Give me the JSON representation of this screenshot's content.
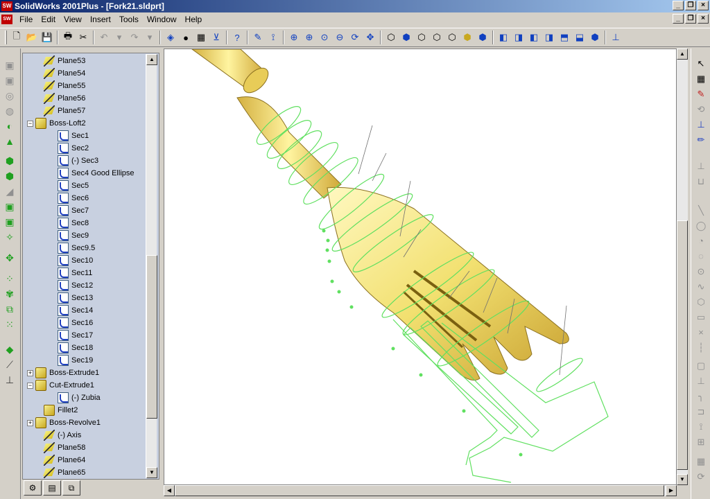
{
  "window": {
    "title": "SolidWorks 2001Plus - [Fork21.sldprt]",
    "app_icon": "solidworks-logo-icon"
  },
  "menu": {
    "items": [
      "File",
      "Edit",
      "View",
      "Insert",
      "Tools",
      "Window",
      "Help"
    ]
  },
  "feature_tree": {
    "items": [
      {
        "label": "Plane53",
        "icon": "plane-icon",
        "indent": 1
      },
      {
        "label": "Plane54",
        "icon": "plane-icon",
        "indent": 1
      },
      {
        "label": "Plane55",
        "icon": "plane-icon",
        "indent": 1
      },
      {
        "label": "Plane56",
        "icon": "plane-icon",
        "indent": 1
      },
      {
        "label": "Plane57",
        "icon": "plane-icon",
        "indent": 1
      },
      {
        "label": "Boss-Loft2",
        "icon": "loft-icon",
        "indent": 0,
        "expander": "−"
      },
      {
        "label": "Sec1",
        "icon": "sketch-icon",
        "indent": 2
      },
      {
        "label": "Sec2",
        "icon": "sketch-icon",
        "indent": 2
      },
      {
        "label": "(-) Sec3",
        "icon": "sketch-icon",
        "indent": 2
      },
      {
        "label": "Sec4 Good Ellipse",
        "icon": "sketch-icon",
        "indent": 2
      },
      {
        "label": "Sec5",
        "icon": "sketch-icon",
        "indent": 2
      },
      {
        "label": "Sec6",
        "icon": "sketch-icon",
        "indent": 2
      },
      {
        "label": "Sec7",
        "icon": "sketch-icon",
        "indent": 2
      },
      {
        "label": "Sec8",
        "icon": "sketch-icon",
        "indent": 2
      },
      {
        "label": "Sec9",
        "icon": "sketch-icon",
        "indent": 2
      },
      {
        "label": "Sec9.5",
        "icon": "sketch-icon",
        "indent": 2
      },
      {
        "label": "Sec10",
        "icon": "sketch-icon",
        "indent": 2
      },
      {
        "label": "Sec11",
        "icon": "sketch-icon",
        "indent": 2
      },
      {
        "label": "Sec12",
        "icon": "sketch-icon",
        "indent": 2
      },
      {
        "label": "Sec13",
        "icon": "sketch-icon",
        "indent": 2
      },
      {
        "label": "Sec14",
        "icon": "sketch-icon",
        "indent": 2
      },
      {
        "label": "Sec16",
        "icon": "sketch-icon",
        "indent": 2
      },
      {
        "label": "Sec17",
        "icon": "sketch-icon",
        "indent": 2
      },
      {
        "label": "Sec18",
        "icon": "sketch-icon",
        "indent": 2
      },
      {
        "label": "Sec19",
        "icon": "sketch-icon",
        "indent": 2
      },
      {
        "label": "Boss-Extrude1",
        "icon": "extrude-icon",
        "indent": 0,
        "expander": "+"
      },
      {
        "label": "Cut-Extrude1",
        "icon": "cut-extrude-icon",
        "indent": 0,
        "expander": "−"
      },
      {
        "label": "(-) Zubia",
        "icon": "sketch-icon",
        "indent": 2
      },
      {
        "label": "Fillet2",
        "icon": "fillet-icon",
        "indent": 1
      },
      {
        "label": "Boss-Revolve1",
        "icon": "revolve-icon",
        "indent": 0,
        "expander": "+"
      },
      {
        "label": "(-) Axis",
        "icon": "axis-icon",
        "indent": 1
      },
      {
        "label": "Plane58",
        "icon": "plane-icon",
        "indent": 1
      },
      {
        "label": "Plane64",
        "icon": "plane-icon",
        "indent": 1
      },
      {
        "label": "Plane65",
        "icon": "plane-icon",
        "indent": 1
      }
    ],
    "tabs": [
      "feature-manager-tab-icon",
      "property-manager-tab-icon",
      "configuration-manager-tab-icon"
    ]
  },
  "colors": {
    "model_fill": "#f0e070",
    "sketch_lines": "#60e060",
    "tree_background": "#c8d0e0"
  }
}
